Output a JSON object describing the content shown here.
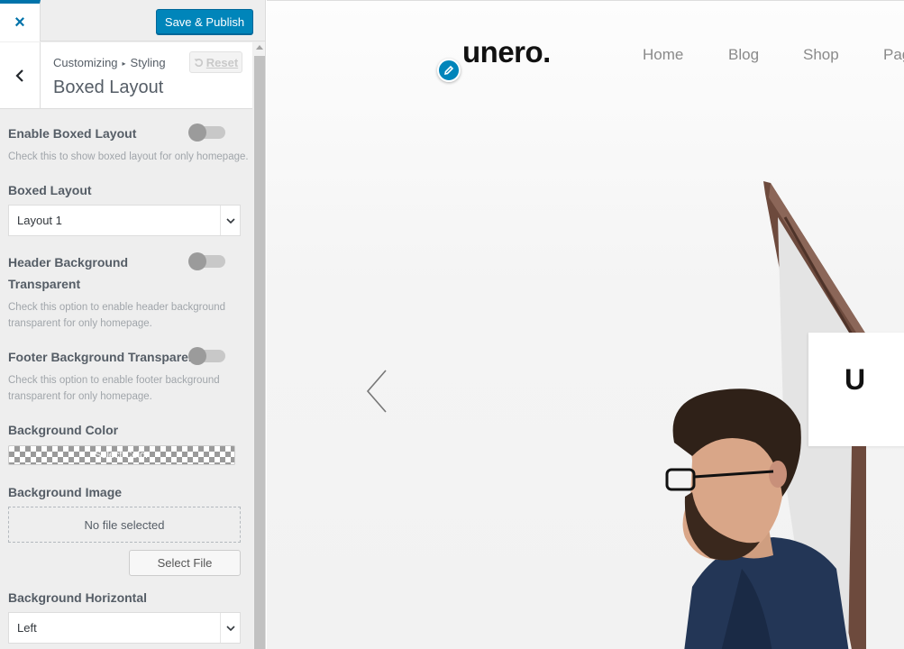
{
  "topbar": {
    "close_icon": "×",
    "publish_label": "Save & Publish"
  },
  "section": {
    "breadcrumb_parent": "Customizing",
    "breadcrumb_child": "Styling",
    "title": "Boxed Layout",
    "reset_label": "Reset"
  },
  "controls": {
    "boxed_toggle": {
      "label": "Enable Boxed Layout",
      "description": "Check this to show boxed layout for only homepage.",
      "enabled": false
    },
    "boxed_layout": {
      "label": "Boxed Layout",
      "value": "Layout 1"
    },
    "header_transparent": {
      "label_line1": "Header Background",
      "label_line2": "Transparent",
      "description_line1": "Check this option to enable header background",
      "description_line2": "transparent for only homepage.",
      "enabled": false
    },
    "footer_transparent": {
      "label": "Footer Background Transparent",
      "description_line1": "Check this option to enable footer background",
      "description_line2": "transparent for only homepage.",
      "enabled": false
    },
    "background_color": {
      "label": "Background Color",
      "button_label": "Select Color"
    },
    "background_image": {
      "label": "Background Image",
      "placeholder": "No file selected",
      "button_label": "Select File"
    },
    "background_horizontal": {
      "label": "Background Horizontal",
      "value": "Left"
    }
  },
  "preview": {
    "logo": "unero.",
    "nav": [
      "Home",
      "Blog",
      "Shop",
      "Pag"
    ],
    "slide_card_text": "U"
  },
  "colors": {
    "accent": "#0073aa",
    "publish": "#0085ba",
    "sidebar_bg": "#eeeeee"
  }
}
